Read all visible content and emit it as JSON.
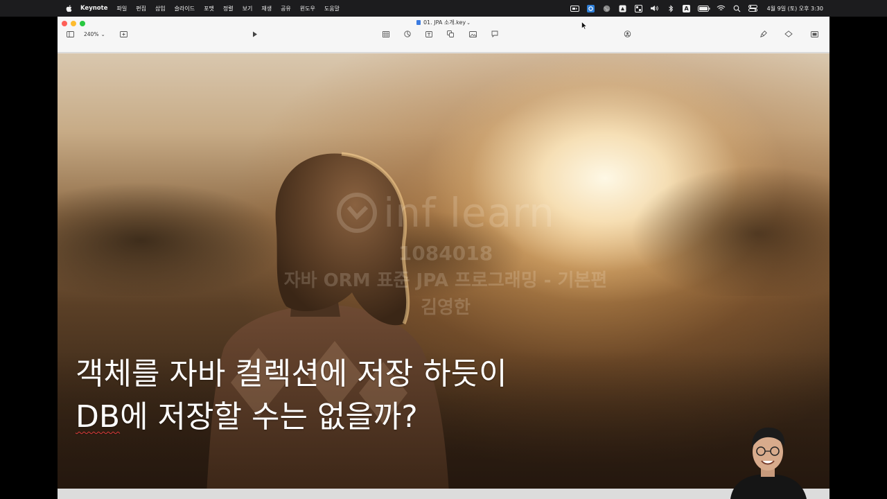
{
  "menubar": {
    "app_name": "Keynote",
    "menus": [
      "파일",
      "편집",
      "삽입",
      "슬라이드",
      "포맷",
      "정렬",
      "보기",
      "재생",
      "공유",
      "윈도우",
      "도움말"
    ],
    "clock": "4월 9일 (토) 오후 3:30",
    "status_icons": [
      "screen-record-icon",
      "app-status-icon",
      "globe-icon",
      "drive-icon",
      "control-icon",
      "volume-icon",
      "bluetooth-icon",
      "input-source-icon",
      "battery-icon",
      "wifi-icon",
      "spotlight-icon",
      "control-center-icon"
    ],
    "input_source_label": "A"
  },
  "window": {
    "title": "01. JPA 소개.key",
    "zoom": "240%",
    "zoom_chevron": "⌄",
    "title_chevron": "⌄"
  },
  "slide": {
    "text_lines": [
      "객체를 자바 컬렉션에 저장 하듯이",
      "에 저장할 수는 없을까?"
    ],
    "underlined_word": "DB"
  },
  "watermark": {
    "logo_text": "inf learn",
    "id": "1084018",
    "course": "자바 ORM 표준 JPA 프로그래밍 - 기본편",
    "author": "김영한"
  },
  "colors": {
    "menubar_bg": "#1c1c1e",
    "toolbar_bg": "#f6f6f6",
    "close": "#fe5f57",
    "minimize": "#febc2e",
    "maximize": "#28c840",
    "spellcheck_underline": "#e03a3a"
  }
}
